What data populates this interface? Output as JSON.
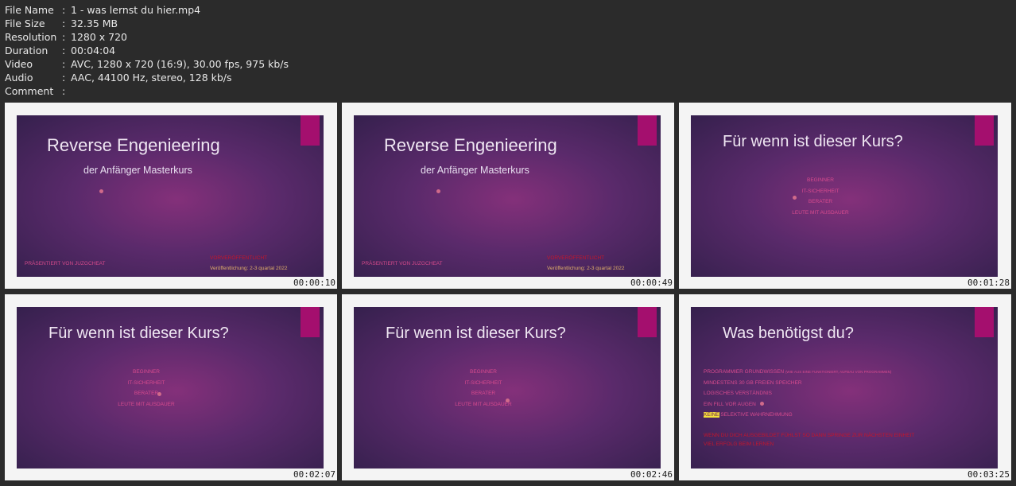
{
  "meta": {
    "rows": [
      {
        "key": "File Name",
        "value": "1 - was lernst du hier.mp4"
      },
      {
        "key": "File Size",
        "value": "32.35 MB"
      },
      {
        "key": "Resolution",
        "value": "1280 x 720"
      },
      {
        "key": "Duration",
        "value": "00:04:04"
      },
      {
        "key": "Video",
        "value": "AVC, 1280 x 720 (16:9), 30.00 fps, 975 kb/s"
      },
      {
        "key": "Audio",
        "value": "AAC, 44100 Hz, stereo, 128 kb/s"
      },
      {
        "key": "Comment",
        "value": ""
      }
    ]
  },
  "thumbs": [
    {
      "timestamp": "00:00:10",
      "title": "Reverse Engenieering",
      "subtitle": "der Anfänger Masterkurs",
      "presenter": "PRÄSENTIERT VON JUZGCHEAT",
      "red_line": "VORVERÖFFENTLICHT",
      "release": "Veröffentlichung:   2-3 quartal 2022"
    },
    {
      "timestamp": "00:00:49",
      "title": "Reverse Engenieering",
      "subtitle": "der Anfänger Masterkurs",
      "presenter": "PRÄSENTIERT VON JUZGCHEAT",
      "red_line": "VORVERÖFFENTLICHT",
      "release": "Veröffentlichung:   2-3 quartal 2022"
    },
    {
      "timestamp": "00:01:28",
      "title": "Für wenn ist dieser Kurs?",
      "items": [
        "BEGINNER",
        "IT-SICHERHEIT",
        "BERATER",
        "LEUTE MIT AUSDAUER"
      ]
    },
    {
      "timestamp": "00:02:07",
      "title": "Für wenn ist dieser Kurs?",
      "items": [
        "BEGINNER",
        "IT-SICHERHEIT",
        "BERATER",
        "LEUTE MIT AUSDAUER"
      ]
    },
    {
      "timestamp": "00:02:46",
      "title": "Für wenn ist dieser Kurs?",
      "items": [
        "BEGINNER",
        "IT-SICHERHEIT",
        "BERATER",
        "LEUTE MIT AUSDAUER"
      ]
    },
    {
      "timestamp": "00:03:25",
      "title": "Was benötigst du?",
      "items": [
        "PROGRAMMIER GRUNDWISSEN",
        "MINDESTENS 30 GB FREIEN SPEICHER",
        "LOGISCHES VERSTÄNDNIS",
        "EIN FILL VOR AUGEN",
        "SELEKTIVE WAHRNEHMUNG"
      ],
      "item1_suffix": "(WIE AUS EINE FUNKTIONIERT, AUFBAU VON PROGRAMMEN)",
      "highlight_word": "KEINE",
      "note_line1": "WENN DU DICH AUSGEBILDET FÜHLST SO DANN SPRINGE ZUR NÄCHSTEN EINHEIT",
      "note_line2": "VIEL ERFOLG BEIM LERNEN"
    }
  ],
  "colors": {
    "ribbon": "#a40f6e",
    "accent_text": "#d84b8e",
    "highlight": "#f4e23a"
  }
}
